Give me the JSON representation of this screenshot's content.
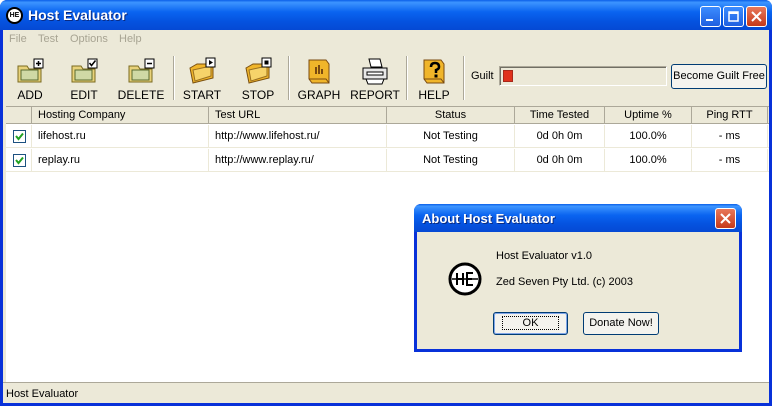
{
  "window": {
    "title": "Host Evaluator"
  },
  "menu": [
    "File",
    "Test",
    "Options",
    "Help"
  ],
  "toolbar": {
    "add": "ADD",
    "edit": "EDIT",
    "delete": "DELETE",
    "start": "START",
    "stop": "STOP",
    "graph": "GRAPH",
    "report": "REPORT",
    "help": "HELP"
  },
  "guilt": {
    "label": "Guilt",
    "level_fraction": 0.06,
    "button": "Become Guilt Free",
    "fill_color": "#e0311c"
  },
  "table": {
    "headers": [
      "Hosting Company",
      "Test URL",
      "Status",
      "Time Tested",
      "Uptime %",
      "Ping RTT"
    ],
    "rows": [
      {
        "checked": true,
        "company": "lifehost.ru",
        "url": "http://www.lifehost.ru/",
        "status": "Not Testing",
        "time": "0d 0h 0m",
        "uptime": "100.0%",
        "ping": "- ms"
      },
      {
        "checked": true,
        "company": "replay.ru",
        "url": "http://www.replay.ru/",
        "status": "Not Testing",
        "time": "0d 0h 0m",
        "uptime": "100.0%",
        "ping": "- ms"
      }
    ]
  },
  "statusbar": {
    "text": "Host Evaluator"
  },
  "dialog": {
    "title": "About Host Evaluator",
    "line1": "Host Evaluator v1.0",
    "line2": "Zed Seven Pty Ltd. (c) 2003",
    "ok": "OK",
    "donate": "Donate Now!"
  },
  "icons": {
    "app": "host-evaluator-logo-icon",
    "add": "folder-add-icon",
    "edit": "folder-edit-icon",
    "delete": "folder-delete-icon",
    "start": "folder-play-icon",
    "stop": "folder-stop-icon",
    "graph": "book-graph-icon",
    "report": "printer-icon",
    "help": "book-help-icon"
  }
}
